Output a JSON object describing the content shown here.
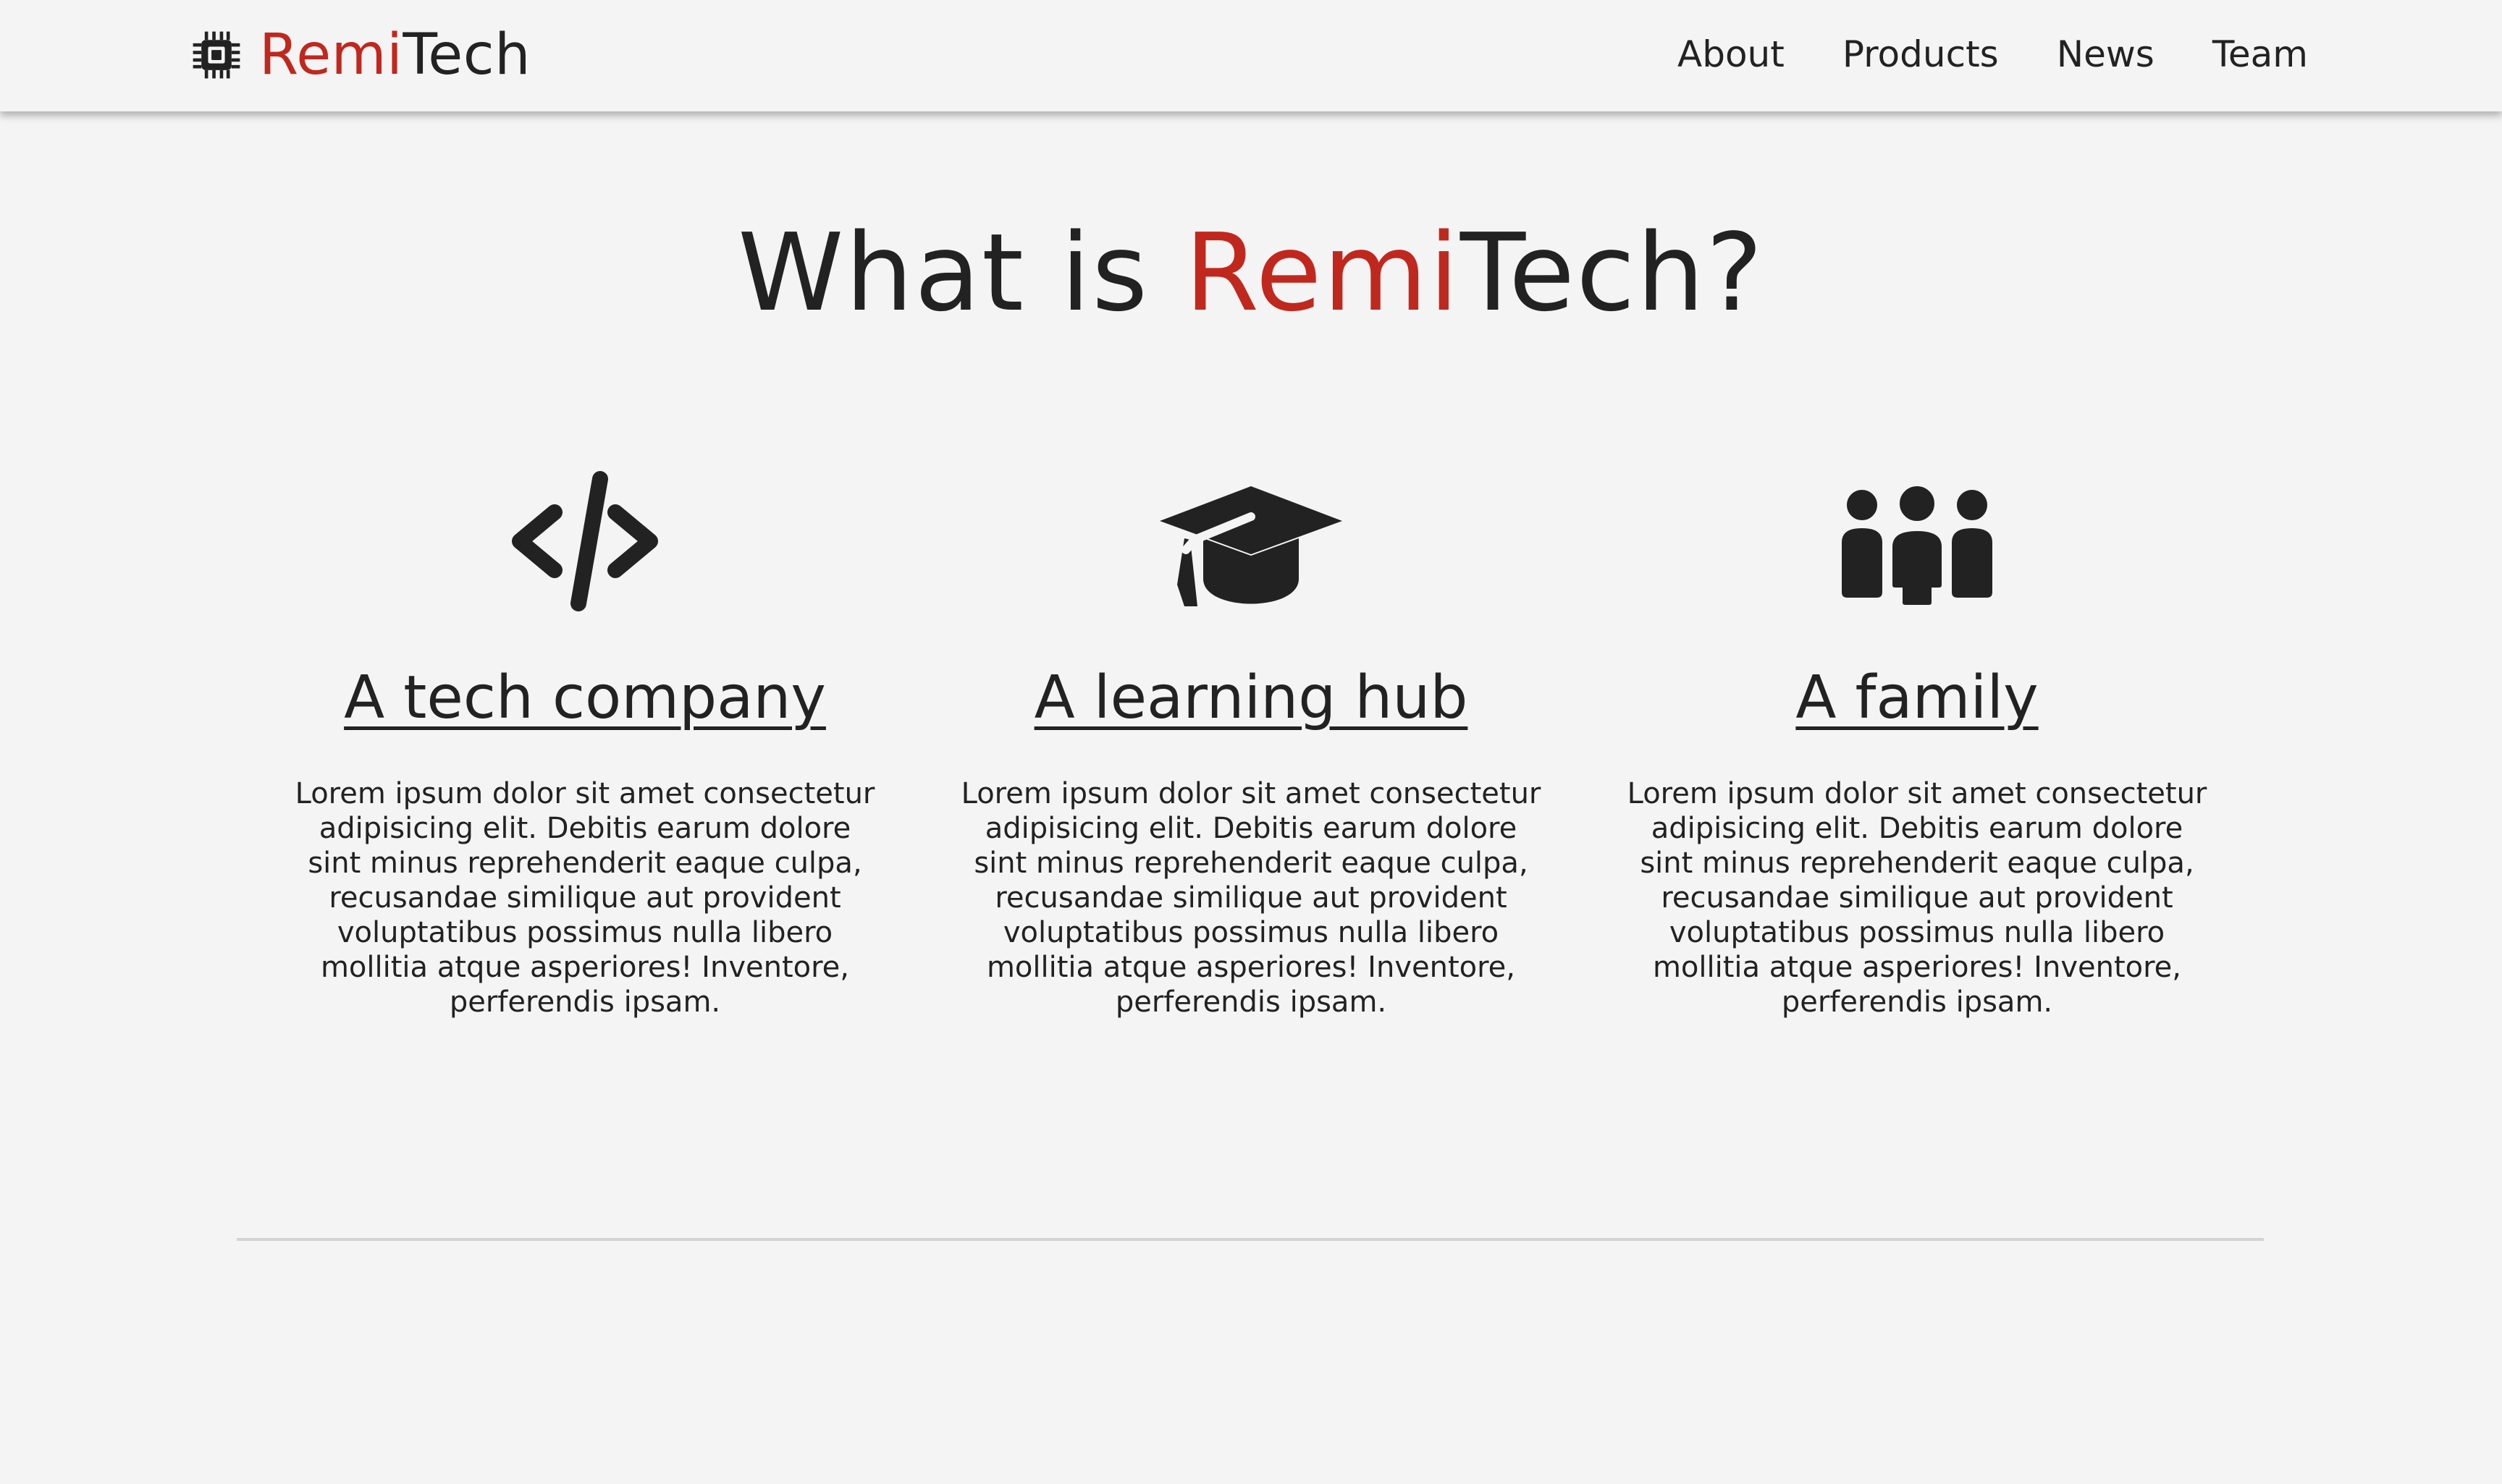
{
  "brand": {
    "part1": "Remi",
    "part2": "Tech",
    "icon": "chip-icon"
  },
  "nav": {
    "items": [
      "About",
      "Products",
      "News",
      "Team"
    ]
  },
  "hero": {
    "prefix": "What is ",
    "brand1": "Remi",
    "brand2": "Tech",
    "suffix": "?"
  },
  "features": [
    {
      "icon": "code-icon",
      "title": "A tech company",
      "text": "Lorem ipsum dolor sit amet consectetur adipisicing elit. Debitis earum dolore sint minus reprehenderit eaque culpa, recusandae similique aut provident voluptatibus possimus nulla libero mollitia atque asperiores! Inventore, perferendis ipsam."
    },
    {
      "icon": "graduation-cap-icon",
      "title": "A learning hub",
      "text": "Lorem ipsum dolor sit amet consectetur adipisicing elit. Debitis earum dolore sint minus reprehenderit eaque culpa, recusandae similique aut provident voluptatibus possimus nulla libero mollitia atque asperiores! Inventore, perferendis ipsam."
    },
    {
      "icon": "people-group-icon",
      "title": "A family",
      "text": "Lorem ipsum dolor sit amet consectetur adipisicing elit. Debitis earum dolore sint minus reprehenderit eaque culpa, recusandae similique aut provident voluptatibus possimus nulla libero mollitia atque asperiores! Inventore, perferendis ipsam."
    }
  ],
  "colors": {
    "accent": "#c0281e",
    "text": "#222222",
    "background": "#f4f4f4",
    "divider": "#d3d3d3"
  }
}
